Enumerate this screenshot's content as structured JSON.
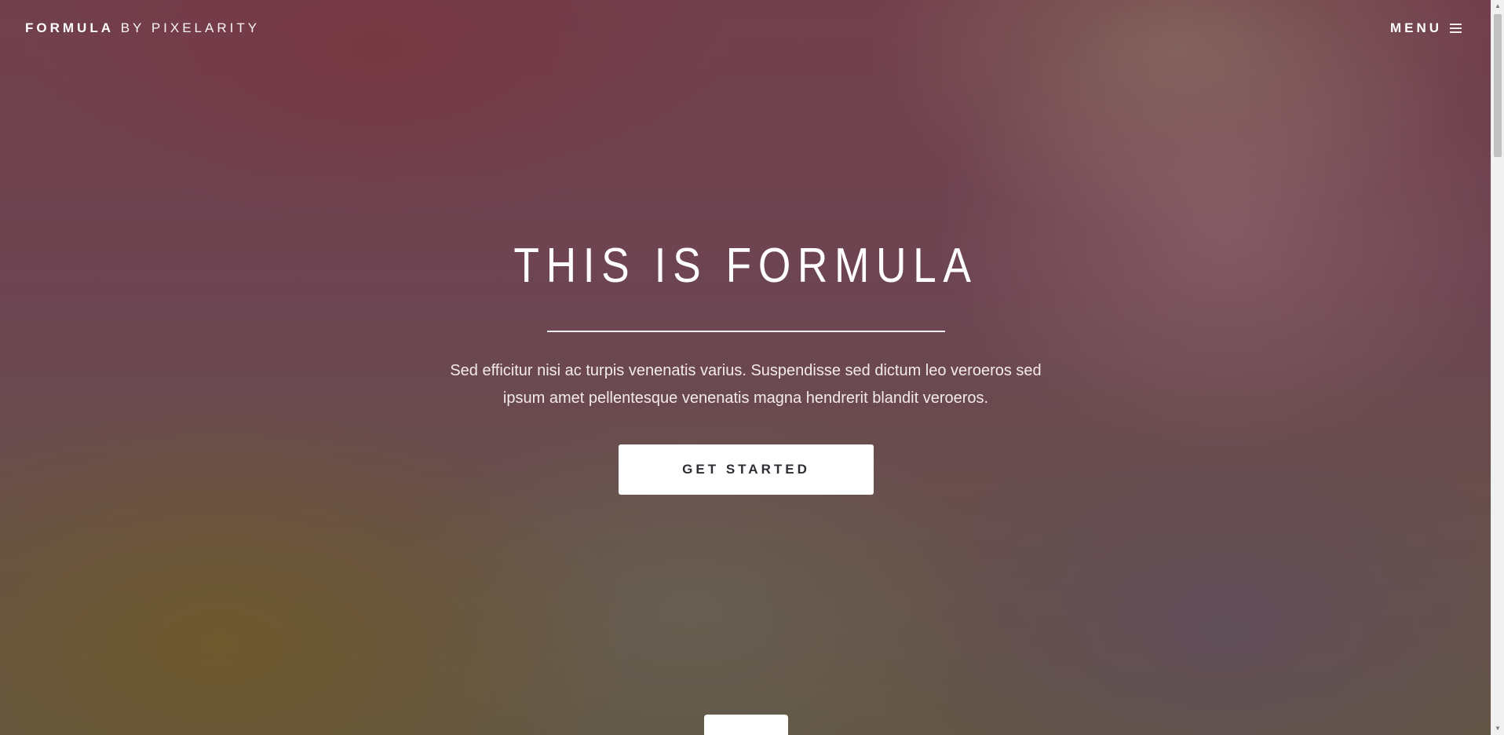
{
  "header": {
    "brand_strong": "FORMULA",
    "brand_light": "BY PIXELARITY",
    "menu_label": "MENU",
    "menu_icon": "hamburger-icon"
  },
  "hero": {
    "title": "THIS IS FORMULA",
    "description": "Sed efficitur nisi ac turpis venenatis varius. Suspendisse sed dictum leo veroeros sed ipsum amet pellentesque venenatis magna hendrerit blandit veroeros.",
    "cta_label": "GET STARTED"
  },
  "scrollbar": {
    "up_icon": "scroll-up-arrow-icon",
    "down_icon": "scroll-down-arrow-icon"
  },
  "colors": {
    "text": "#ffffff",
    "button_background": "#ffffff",
    "button_text": "#2d2d33"
  }
}
